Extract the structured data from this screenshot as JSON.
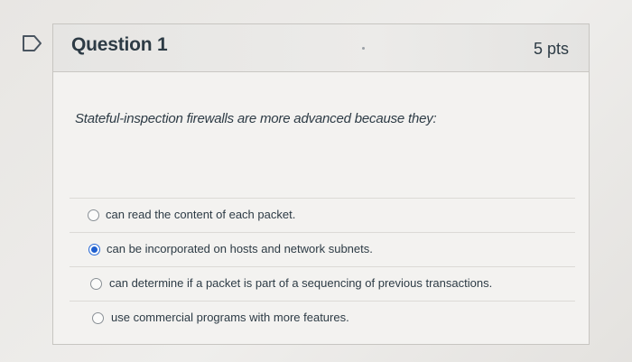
{
  "question": {
    "title": "Question 1",
    "points": "5 pts",
    "text": "Stateful-inspection firewalls are more advanced because they:"
  },
  "answers": [
    {
      "label": "can read the content of each packet.",
      "selected": false
    },
    {
      "label": "can be incorporated on hosts and network subnets.",
      "selected": true
    },
    {
      "label": "can determine if a packet is part of a sequencing of previous transactions.",
      "selected": false
    },
    {
      "label": "use commercial programs with more features.",
      "selected": false
    }
  ],
  "colors": {
    "selected_radio": "#1f5fcf",
    "text": "#2d3b45",
    "border": "#c7c5c1"
  },
  "icons": {
    "flag": "flag-icon"
  }
}
